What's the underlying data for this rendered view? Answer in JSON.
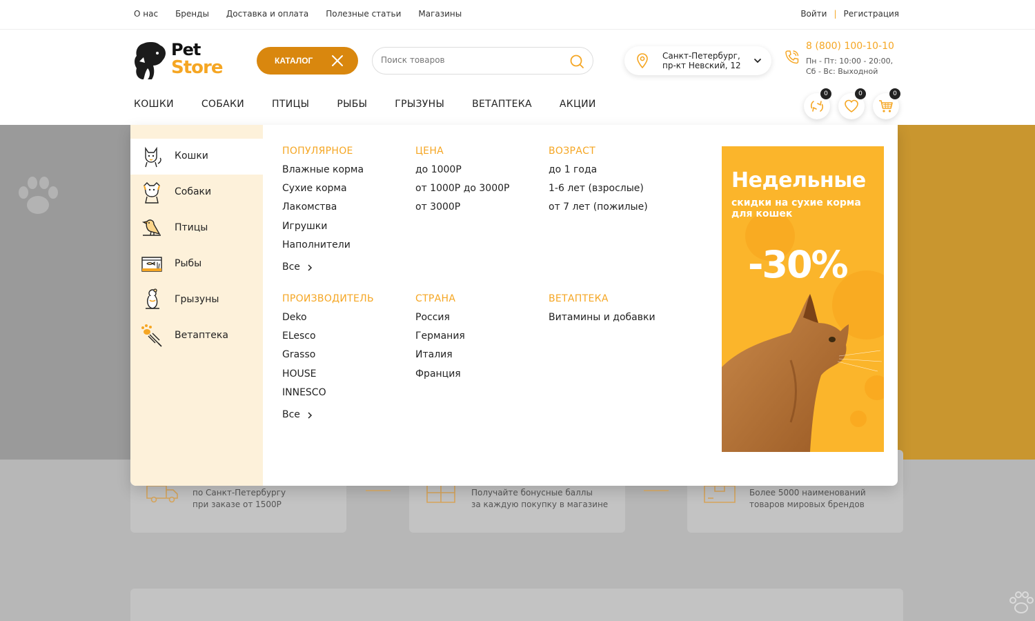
{
  "topbar": {
    "links": [
      "О нас",
      "Бренды",
      "Доставка и оплата",
      "Полезные статьи",
      "Магазины"
    ],
    "login": "Войти",
    "register": "Регистрация"
  },
  "header": {
    "logo_line1": "Pet",
    "logo_line2": "Store",
    "catalog_label": "КАТАЛОГ",
    "search_placeholder": "Поиск товаров",
    "location_line1": "Санкт-Петербург,",
    "location_line2": "пр-кт Невский, 12",
    "phone": "8 (800) 100-10-10",
    "hours_line1": "Пн - Пт: 10:00 - 20:00,",
    "hours_line2": "Сб - Вс: Выходной",
    "counters": {
      "compare": "0",
      "favorites": "0",
      "cart": "0"
    }
  },
  "nav": [
    "КОШКИ",
    "СОБАКИ",
    "ПТИЦЫ",
    "РЫБЫ",
    "ГРЫЗУНЫ",
    "ВЕТАПТЕКА",
    "АКЦИИ"
  ],
  "menu": {
    "categories": [
      "Кошки",
      "Собаки",
      "Птицы",
      "Рыбы",
      "Грызуны",
      "Ветаптека"
    ],
    "active_category": "Кошки",
    "columns": {
      "popular": {
        "title": "ПОПУЛЯРНОЕ",
        "items": [
          "Влажные корма",
          "Сухие корма",
          "Лакомства",
          "Игрушки",
          "Наполнители"
        ],
        "all": "Все"
      },
      "price": {
        "title": "ЦЕНА",
        "items": [
          "до 1000Р",
          "от 1000Р до 3000Р",
          "от 3000Р"
        ]
      },
      "age": {
        "title": "ВОЗРАСТ",
        "items": [
          "до 1 года",
          "1-6 лет (взрослые)",
          "от 7 лет (пожилые)"
        ]
      },
      "maker": {
        "title": "ПРОИЗВОДИТЕЛЬ",
        "items": [
          "Deko",
          "ELesco",
          "Grasso",
          "HOUSE",
          "INNESCO"
        ],
        "all": "Все"
      },
      "country": {
        "title": "СТРАНА",
        "items": [
          "Россия",
          "Германия",
          "Италия",
          "Франция"
        ]
      },
      "vet": {
        "title": "ВЕТАПТЕКА",
        "items": [
          "Витамины и добавки"
        ]
      }
    },
    "promo": {
      "title": "Недельные",
      "subtitle": "скидки на сухие корма для кошек",
      "discount": "-30%"
    }
  },
  "benefits": [
    {
      "line1": "по Санкт-Петербургу",
      "line2": "при заказе от 1500Р"
    },
    {
      "line1": "Получайте бонусные баллы",
      "line2": "за каждую покупку в магазине"
    },
    {
      "line1": "Более 5000 наименований",
      "line2": "товаров мировых брендов"
    }
  ],
  "colors": {
    "accent": "#f5a623",
    "catalog_button": "#d9870e",
    "menu_sidebar": "#fdf1da",
    "promo_bg": "#fbb52b"
  }
}
